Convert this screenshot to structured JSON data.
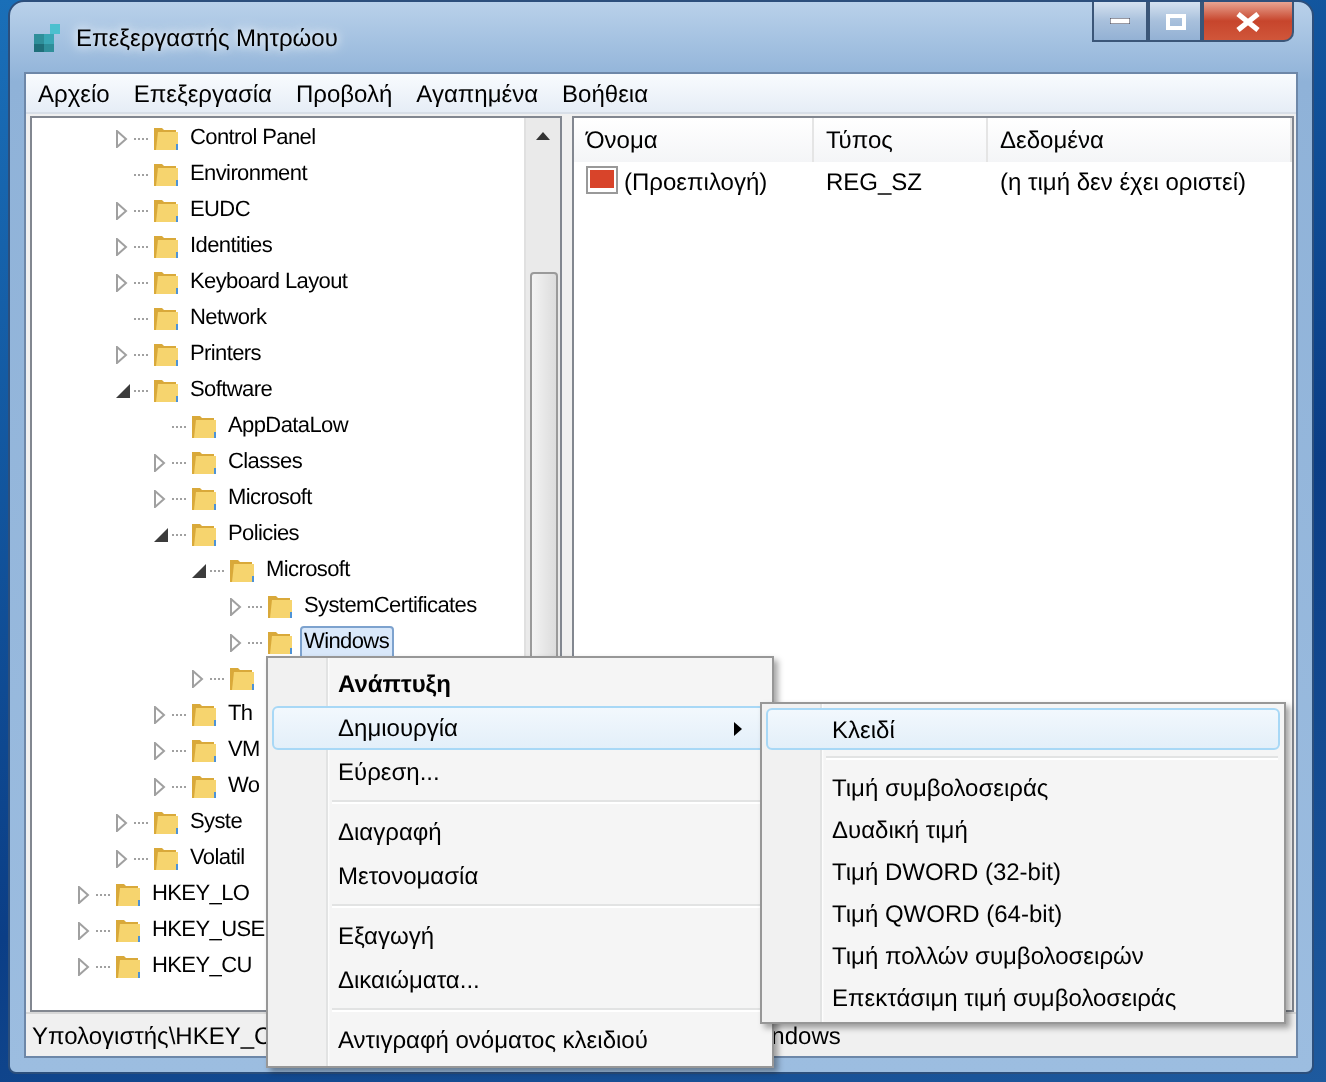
{
  "window": {
    "title": "Επεξεργαστής Μητρώου"
  },
  "menu_bar": [
    "Αρχείο",
    "Επεξεργασία",
    "Προβολή",
    "Αγαπημένα",
    "Βοήθεια"
  ],
  "tree": {
    "upper_items": [
      {
        "label": "Control Panel",
        "expanded": false,
        "selected": false
      },
      {
        "label": "Environment",
        "selected": false
      },
      {
        "label": "EUDC",
        "expanded": false,
        "selected": false
      },
      {
        "label": "Identities",
        "expanded": false,
        "selected": false
      },
      {
        "label": "Keyboard Layout",
        "expanded": false,
        "selected": false
      },
      {
        "label": "Network",
        "selected": false
      },
      {
        "label": "Printers",
        "expanded": false,
        "selected": false
      },
      {
        "label": "Software",
        "expanded": true,
        "selected": false,
        "children": [
          {
            "label": "AppDataLow",
            "selected": false
          },
          {
            "label": "Classes",
            "expanded": false,
            "selected": false
          },
          {
            "label": "Microsoft",
            "expanded": false,
            "selected": false
          },
          {
            "label": "Policies",
            "expanded": true,
            "selected": false,
            "children": [
              {
                "label": "Microsoft",
                "expanded": true,
                "selected": false,
                "children": [
                  {
                    "label": "SystemCertificates",
                    "expanded": false,
                    "selected": false
                  },
                  {
                    "label": "Windows",
                    "expanded": false,
                    "selected": true
                  }
                ]
              },
              {
                "expanded": false
              }
            ]
          },
          {
            "label": "Th",
            "expanded": false,
            "selected": false
          },
          {
            "label": "VM",
            "expanded": false,
            "selected": false
          },
          {
            "label": "Wo",
            "expanded": false,
            "selected": false
          }
        ]
      },
      {
        "label": "Syste",
        "expanded": false,
        "selected": false
      },
      {
        "label": "Volatil",
        "expanded": false,
        "selected": false
      }
    ],
    "root_items": [
      {
        "label": "HKEY_LO",
        "expanded": false,
        "selected": false
      },
      {
        "label": "HKEY_USE",
        "expanded": false,
        "selected": false
      },
      {
        "label": "HKEY_CU",
        "expanded": false,
        "selected": false
      }
    ]
  },
  "values_table": {
    "columns": [
      "Όνομα",
      "Τύπος",
      "Δεδομένα"
    ],
    "rows": [
      {
        "name": "(Προεπιλογή)",
        "type": "REG_SZ",
        "data": "(η τιμή δεν έχει οριστεί)"
      }
    ]
  },
  "status_bar": [
    "Υπολογιστής\\HKEY_C",
    "ndows"
  ],
  "context_menu": {
    "groups": [
      [
        {
          "label": "Ανάπτυξη",
          "default": true,
          "highlighted": false,
          "submenu": false
        },
        {
          "label": "Δημιουργία",
          "default": false,
          "highlighted": true,
          "submenu": true
        },
        {
          "label": "Εύρεση...",
          "default": false,
          "highlighted": false,
          "submenu": false
        }
      ],
      [
        {
          "label": "Διαγραφή",
          "default": false,
          "highlighted": false,
          "submenu": false
        },
        {
          "label": "Μετονομασία",
          "default": false,
          "highlighted": false,
          "submenu": false
        }
      ],
      [
        {
          "label": "Εξαγωγή",
          "default": false,
          "highlighted": false,
          "submenu": false
        },
        {
          "label": "Δικαιώματα...",
          "default": false,
          "highlighted": false,
          "submenu": false
        }
      ],
      [
        {
          "label": "Αντιγραφή ονόματος κλειδιού",
          "default": false,
          "highlighted": false,
          "submenu": false
        }
      ]
    ]
  },
  "submenu": {
    "groups": [
      [
        {
          "label": "Κλειδί",
          "highlighted": true
        }
      ],
      [
        {
          "label": "Τιμή συμβολοσειράς",
          "highlighted": false
        },
        {
          "label": "Δυαδική τιμή",
          "highlighted": false
        },
        {
          "label": "Τιμή DWORD (32-bit)",
          "highlighted": false
        },
        {
          "label": "Τιμή QWORD (64-bit)",
          "highlighted": false
        },
        {
          "label": "Τιμή πολλών συμβολοσειρών",
          "highlighted": false
        },
        {
          "label": "Επεκτάσιμη τιμή συμβολοσειράς",
          "highlighted": false
        }
      ]
    ]
  }
}
